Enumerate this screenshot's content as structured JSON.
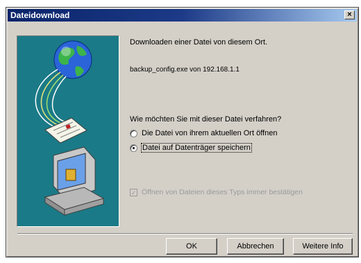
{
  "dialog": {
    "title": "Dateidownload",
    "close_symbol": "×",
    "message": "Downloaden einer Datei von diesem Ort.",
    "file_info": "backup_config.exe von 192.168.1.1",
    "question": "Wie möchten Sie mit dieser Datei verfahren?",
    "options": [
      {
        "label": "Die Datei von ihrem aktuellen Ort öffnen",
        "selected": false
      },
      {
        "label": "Datei auf Datenträger speichern",
        "selected": true
      }
    ],
    "checkbox": {
      "label": "Öffnen von Dateien dieses Typs immer bestätigen",
      "checked": true,
      "enabled": false
    },
    "buttons": {
      "ok": "OK",
      "cancel": "Abbrechen",
      "more_info": "Weitere Info"
    }
  },
  "colors": {
    "title_bar": "#0a246a",
    "illustration_bg": "#1b7a87",
    "dialog_bg": "#d4d0c8"
  },
  "icons": [
    "globe-icon",
    "document-icon",
    "computer-icon",
    "close-icon"
  ]
}
